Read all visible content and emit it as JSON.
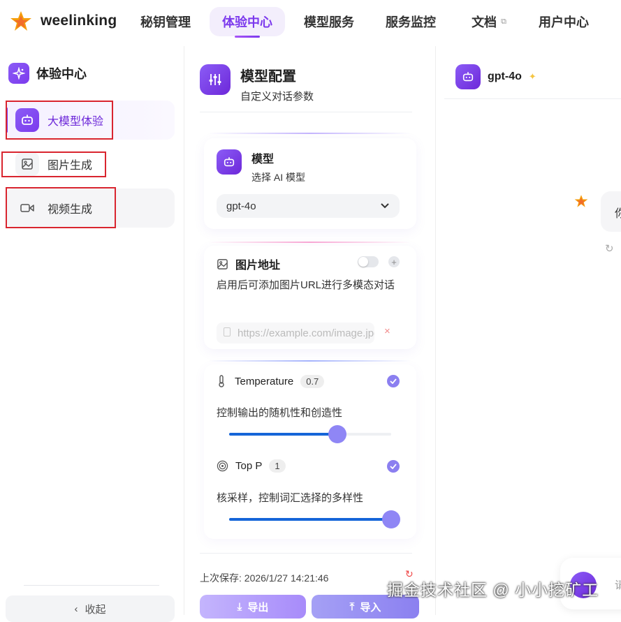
{
  "brand": {
    "name": "weelinking"
  },
  "nav": {
    "items": [
      {
        "label": "秘钥管理"
      },
      {
        "label": "体验中心"
      },
      {
        "label": "模型服务"
      },
      {
        "label": "服务监控"
      },
      {
        "label": "文档"
      },
      {
        "label": "用户中心"
      }
    ],
    "active": "体验中心",
    "external_icon": "external-link-icon"
  },
  "sidebar": {
    "title": "体验中心",
    "items": [
      {
        "label": "大模型体验",
        "icon": "robot-icon",
        "active": true
      },
      {
        "label": "图片生成",
        "icon": "image-icon",
        "active": false
      },
      {
        "label": "视频生成",
        "icon": "video-icon",
        "active": false
      }
    ],
    "collapse_label": "收起"
  },
  "config": {
    "title": "模型配置",
    "subtitle": "自定义对话参数",
    "model": {
      "label": "模型",
      "sublabel": "选择 AI 模型",
      "value": "gpt-4o"
    },
    "image_url": {
      "label": "图片地址",
      "description": "启用后可添加图片URL进行多模态对话",
      "placeholder": "https://example.com/image.jpg",
      "enabled": false
    },
    "temperature": {
      "label": "Temperature",
      "value": "0.7",
      "description": "控制输出的随机性和创造性",
      "fraction": 0.67
    },
    "top_p": {
      "label": "Top P",
      "value": "1",
      "description": "核采样，控制词汇选择的多样性",
      "fraction": 1.0
    },
    "last_saved_label": "上次保存: 2026/1/27 14:21:46",
    "export_label": "导出",
    "import_label": "导入"
  },
  "chat": {
    "model_name": "gpt-4o",
    "partial_message": "你",
    "partial_input": "请"
  },
  "watermark": "掘金技术社区 @ 小小挖矿工",
  "colors": {
    "accent": "#7c3aed",
    "accent_light": "#f3eefc",
    "slider_fill": "#1565d8",
    "knob": "#8f86f5",
    "annotation_red": "#d9252f"
  }
}
